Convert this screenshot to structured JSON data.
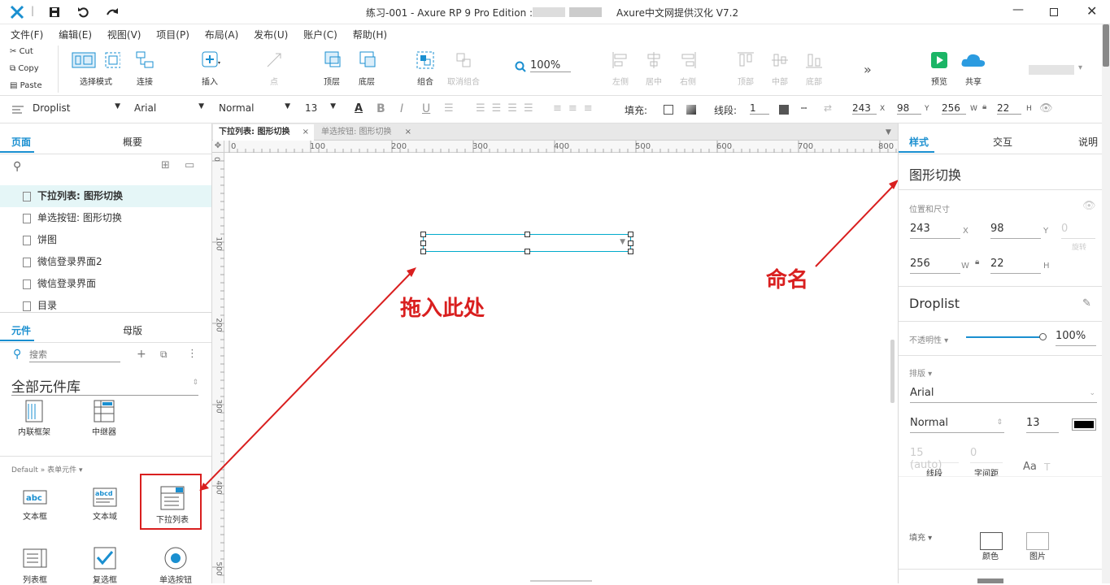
{
  "titlebar": {
    "title_prefix": "练习-001 - Axure RP 9 Pro Edition :",
    "title_suffix": "Axure中文网提供汉化 V7.2"
  },
  "menu": [
    "文件(F)",
    "编辑(E)",
    "视图(V)",
    "项目(P)",
    "布局(A)",
    "发布(U)",
    "账户(C)",
    "帮助(H)"
  ],
  "clipboard": {
    "cut": "Cut",
    "copy": "Copy",
    "paste": "Paste"
  },
  "toolbar": {
    "select_mode": "选择模式",
    "connect": "连接",
    "insert": "插入",
    "point": "点",
    "top_layer": "顶层",
    "bottom_layer": "底层",
    "group": "组合",
    "ungroup": "取消组合",
    "zoom": "100%",
    "left": "左侧",
    "center": "居中",
    "right": "右侧",
    "top": "顶部",
    "middle": "中部",
    "bottom": "底部",
    "preview": "预览",
    "share": "共享"
  },
  "stylebar": {
    "widget_type": "Droplist",
    "font": "Arial",
    "weight": "Normal",
    "size": "13",
    "fill_label": "填充:",
    "line_label": "线段:",
    "line_width": "1",
    "x": "243",
    "y": "98",
    "w": "256",
    "h": "22",
    "x_lbl": "X",
    "y_lbl": "Y",
    "w_lbl": "W",
    "h_lbl": "H"
  },
  "left": {
    "tab_pages": "页面",
    "tab_outline": "概要",
    "pages": [
      "下拉列表: 图形切换",
      "单选按钮: 图形切换",
      "饼图",
      "微信登录界面2",
      "微信登录界面",
      "目录"
    ],
    "tab_widgets": "元件",
    "tab_masters": "母版",
    "search_placeholder": "搜索",
    "library": "全部元件库",
    "lib_items": [
      "内联框架",
      "中继器"
    ],
    "category": "Default » 表单元件 ▾",
    "form_items": [
      "文本框",
      "文本域",
      "下拉列表",
      "列表框",
      "复选框",
      "单选按钮"
    ]
  },
  "canvas_tabs": [
    "下拉列表: 图形切换",
    "单选按钮: 图形切换"
  ],
  "ruler": {
    "h": [
      "0",
      "100",
      "200",
      "300",
      "400",
      "500",
      "600",
      "700",
      "800"
    ],
    "v": [
      "0",
      "100",
      "200",
      "300",
      "400",
      "500"
    ]
  },
  "annotations": {
    "drop_here": "拖入此处",
    "name_it": "命名"
  },
  "right": {
    "tab_style": "样式",
    "tab_interact": "交互",
    "tab_notes": "说明",
    "widget_name": "图形切换",
    "pos_size_label": "位置和尺寸",
    "x": "243",
    "y": "98",
    "rot": "0",
    "rot_lbl": "旋转",
    "w": "256",
    "h": "22",
    "x_lbl": "X",
    "y_lbl": "Y",
    "w_lbl": "W",
    "h_lbl": "H",
    "style_name": "Droplist",
    "opacity_label": "不透明性 ▾",
    "opacity": "100%",
    "opacity_value": 1.0,
    "typography_label": "排版 ▾",
    "font": "Arial",
    "weight": "Normal",
    "size": "13",
    "line_height": "15 (auto)",
    "char_spacing": "0",
    "line_height_lbl": "线段",
    "char_spacing_lbl": "字间距",
    "fill_label": "填充 ▾",
    "fill_color": "颜色",
    "fill_image": "图片"
  },
  "colors": {
    "accent": "#1a8fd0",
    "annotation": "#d91f1f",
    "selection": "#00aacc",
    "active_page": "#e5f6f7"
  }
}
